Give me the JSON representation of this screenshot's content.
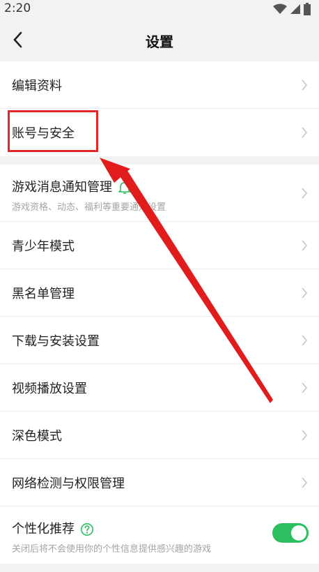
{
  "status_bar": {
    "time": "2:20"
  },
  "header": {
    "title": "设置"
  },
  "groups": [
    {
      "rows": [
        {
          "label": "编辑资料"
        },
        {
          "label": "账号与安全"
        }
      ]
    },
    {
      "rows": [
        {
          "label": "游戏消息通知管理",
          "subtitle": "游戏资格、动态、福利等重要通知设置"
        },
        {
          "label": "青少年模式"
        },
        {
          "label": "黑名单管理"
        },
        {
          "label": "下载与安装设置"
        },
        {
          "label": "视频播放设置"
        },
        {
          "label": "深色模式"
        },
        {
          "label": "网络检测与权限管理"
        },
        {
          "label": "个性化推荐",
          "subtitle": "关闭后将不会使用你的个性信息提供感兴趣的游戏",
          "toggle_on": true
        }
      ]
    }
  ],
  "colors": {
    "accent": "#2bbf60",
    "highlight": "#e12828"
  }
}
